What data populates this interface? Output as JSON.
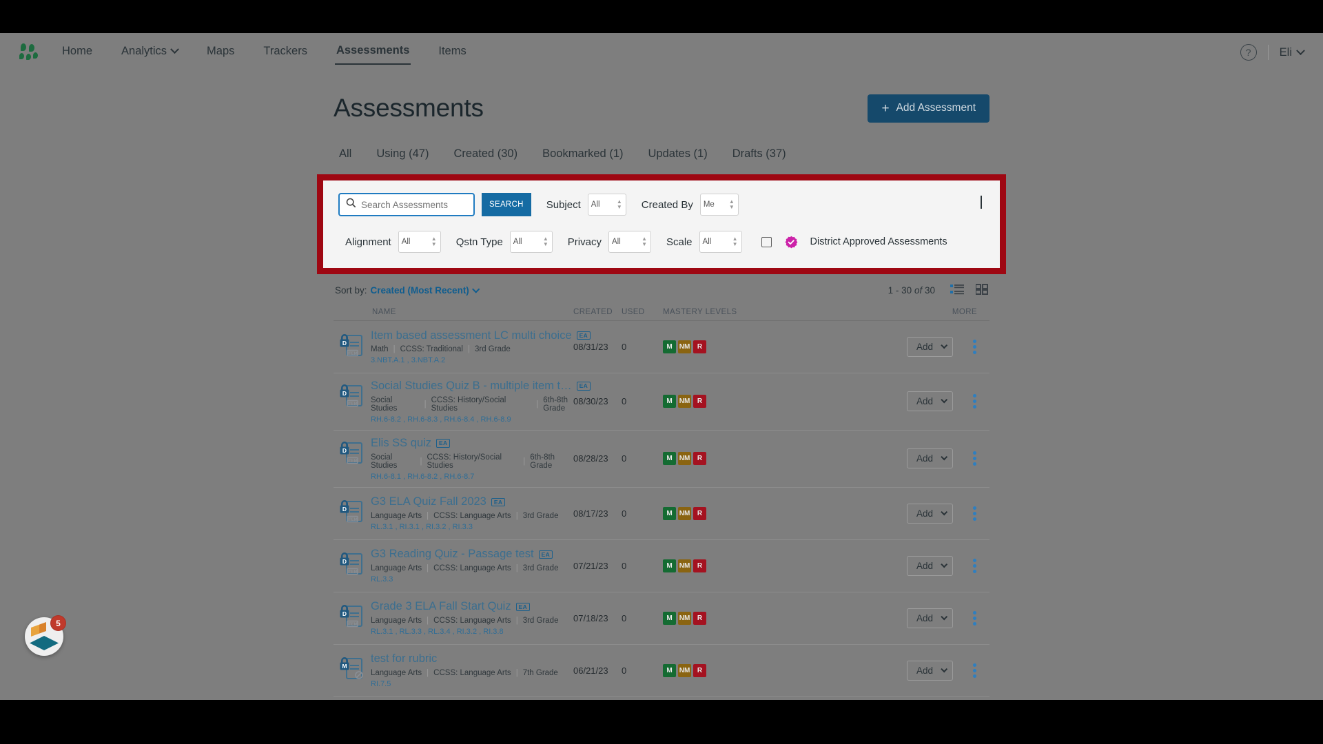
{
  "nav": {
    "logo_name": "app-logo",
    "items": [
      {
        "label": "Home",
        "has_caret": false,
        "active": false
      },
      {
        "label": "Analytics",
        "has_caret": true,
        "active": false
      },
      {
        "label": "Maps",
        "has_caret": false,
        "active": false
      },
      {
        "label": "Trackers",
        "has_caret": false,
        "active": false
      },
      {
        "label": "Assessments",
        "has_caret": false,
        "active": true
      },
      {
        "label": "Items",
        "has_caret": false,
        "active": false
      }
    ],
    "help_glyph": "?",
    "user_label": "Eli"
  },
  "header": {
    "title": "Assessments",
    "add_button": "Add Assessment",
    "add_button_color": "#15496b"
  },
  "tabs": [
    {
      "label": "All"
    },
    {
      "label": "Using (47)"
    },
    {
      "label": "Created (30)"
    },
    {
      "label": "Bookmarked (1)"
    },
    {
      "label": "Updates (1)"
    },
    {
      "label": "Drafts (37)"
    }
  ],
  "highlight": {
    "border_color": "#9e0712"
  },
  "filters": {
    "search_placeholder": "Search Assessments",
    "search_value": "",
    "search_button": "SEARCH",
    "row1": [
      {
        "label": "Subject",
        "value": "All"
      },
      {
        "label": "Created By",
        "value": "Me"
      }
    ],
    "row2": [
      {
        "label": "Alignment",
        "value": "All"
      },
      {
        "label": "Qstn Type",
        "value": "All"
      },
      {
        "label": "Privacy",
        "value": "All"
      },
      {
        "label": "Scale",
        "value": "All"
      }
    ],
    "district_approved_label": "District Approved Assessments",
    "district_approved_checked": false,
    "approved_badge_color": "#cc22a8",
    "collapse_state": "expanded"
  },
  "sort": {
    "prefix": "Sort by:",
    "value": "Created (Most Recent)"
  },
  "pagination": {
    "range": "1 - 30",
    "of": "of",
    "total": "30"
  },
  "table": {
    "columns": [
      "NAME",
      "CREATED",
      "USED",
      "MASTERY LEVELS",
      "MORE"
    ],
    "add_label": "Add",
    "rows": [
      {
        "name": "Item based assessment LC multi choice",
        "ea": "EA",
        "icon": "locked-item-doc-icon",
        "lock_letter": "D",
        "subject": "Math",
        "framework": "CCSS: Traditional",
        "grade": "3rd Grade",
        "standards": "3.NBT.A.1 , 3.NBT.A.2",
        "created": "08/31/23",
        "used": "0",
        "mastery": [
          "M",
          "NM",
          "R"
        ]
      },
      {
        "name": "Social Studies Quiz B - multiple item t…",
        "ea": "EA",
        "icon": "locked-item-doc-icon",
        "lock_letter": "D",
        "subject": "Social Studies",
        "framework": "CCSS: History/Social Studies",
        "grade": "6th-8th Grade",
        "standards": "RH.6-8.2 , RH.6-8.3 , RH.6-8.4 , RH.6-8.9",
        "created": "08/30/23",
        "used": "0",
        "mastery": [
          "M",
          "NM",
          "R"
        ]
      },
      {
        "name": "Elis SS quiz",
        "ea": "EA",
        "icon": "locked-item-doc-icon",
        "lock_letter": "D",
        "subject": "Social Studies",
        "framework": "CCSS: History/Social Studies",
        "grade": "6th-8th Grade",
        "standards": "RH.6-8.1 , RH.6-8.2 , RH.6-8.7",
        "created": "08/28/23",
        "used": "0",
        "mastery": [
          "M",
          "NM",
          "R"
        ]
      },
      {
        "name": "G3 ELA Quiz Fall 2023",
        "ea": "EA",
        "icon": "locked-item-doc-icon",
        "lock_letter": "D",
        "subject": "Language Arts",
        "framework": "CCSS: Language Arts",
        "grade": "3rd Grade",
        "standards": "RL.3.1 , RI.3.1 , RI.3.2 , RI.3.3",
        "created": "08/17/23",
        "used": "0",
        "mastery": [
          "M",
          "NM",
          "R"
        ]
      },
      {
        "name": "G3 Reading Quiz - Passage test",
        "ea": "EA",
        "icon": "locked-item-doc-icon",
        "lock_letter": "D",
        "subject": "Language Arts",
        "framework": "CCSS: Language Arts",
        "grade": "3rd Grade",
        "standards": "RL.3.3",
        "created": "07/21/23",
        "used": "0",
        "mastery": [
          "M",
          "NM",
          "R"
        ]
      },
      {
        "name": "Grade 3 ELA Fall Start Quiz",
        "ea": "EA",
        "icon": "locked-item-doc-icon",
        "lock_letter": "D",
        "subject": "Language Arts",
        "framework": "CCSS: Language Arts",
        "grade": "3rd Grade",
        "standards": "RL.3.1 , RL.3.3 , RL.3.4 , RI.3.2 , RI.3.8",
        "created": "07/18/23",
        "used": "0",
        "mastery": [
          "M",
          "NM",
          "R"
        ]
      },
      {
        "name": "test for rubric",
        "ea": "",
        "icon": "locked-manual-doc-icon",
        "lock_letter": "M",
        "subject": "Language Arts",
        "framework": "CCSS: Language Arts",
        "grade": "7th Grade",
        "standards": "RI.7.5",
        "created": "06/21/23",
        "used": "0",
        "mastery": [
          "M",
          "NM",
          "R"
        ]
      }
    ]
  },
  "fab": {
    "badge_count": "5"
  }
}
